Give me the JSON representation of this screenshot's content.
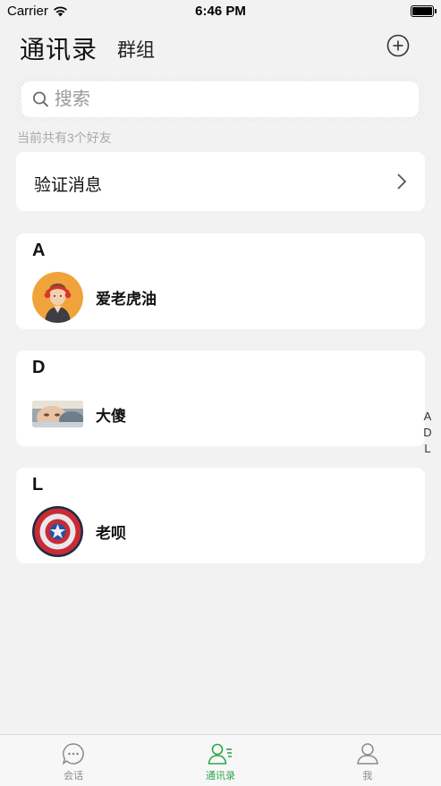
{
  "status_bar": {
    "carrier": "Carrier",
    "time": "6:46 PM"
  },
  "header": {
    "title": "通讯录",
    "group_tab": "群组"
  },
  "search": {
    "placeholder": "搜索"
  },
  "friend_count": "当前共有3个好友",
  "verify": {
    "label": "验证消息"
  },
  "groups": [
    {
      "letter": "A",
      "contacts": [
        {
          "name": "爱老虎油"
        }
      ]
    },
    {
      "letter": "D",
      "contacts": [
        {
          "name": "大傻"
        }
      ]
    },
    {
      "letter": "L",
      "contacts": [
        {
          "name": "老呗"
        }
      ]
    }
  ],
  "index_letters": [
    "A",
    "D",
    "L"
  ],
  "tabs": [
    {
      "label": "会话",
      "active": false
    },
    {
      "label": "通讯录",
      "active": true
    },
    {
      "label": "我",
      "active": false
    }
  ],
  "colors": {
    "accent": "#2ba84a",
    "background": "#f2f2f2"
  }
}
